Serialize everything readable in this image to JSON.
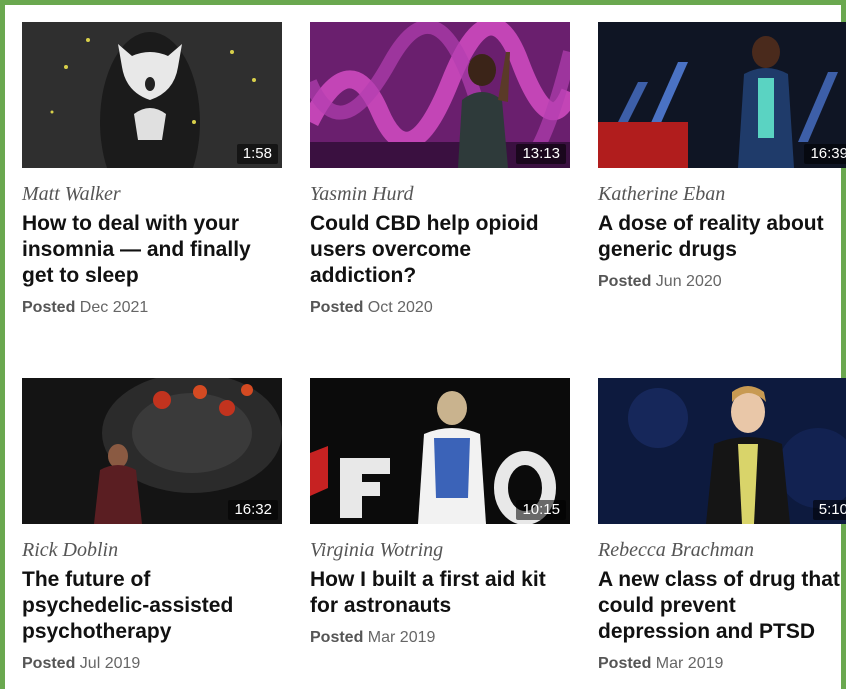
{
  "talks": [
    {
      "speaker": "Matt Walker",
      "title": "How to deal with your insomnia — and finally get to sleep",
      "duration": "1:58",
      "posted_label": "Posted",
      "posted_date": "Dec 2021"
    },
    {
      "speaker": "Yasmin Hurd",
      "title": "Could CBD help opioid users overcome addiction?",
      "duration": "13:13",
      "posted_label": "Posted",
      "posted_date": "Oct 2020"
    },
    {
      "speaker": "Katherine Eban",
      "title": "A dose of reality about generic drugs",
      "duration": "16:39",
      "posted_label": "Posted",
      "posted_date": "Jun 2020"
    },
    {
      "speaker": "Rick Doblin",
      "title": "The future of psychedelic-assisted psychotherapy",
      "duration": "16:32",
      "posted_label": "Posted",
      "posted_date": "Jul 2019"
    },
    {
      "speaker": "Virginia Wotring",
      "title": "How I built a first aid kit for astronauts",
      "duration": "10:15",
      "posted_label": "Posted",
      "posted_date": "Mar 2019"
    },
    {
      "speaker": "Rebecca Brachman",
      "title": "A new class of drug that could prevent depression and PTSD",
      "duration": "5:10",
      "posted_label": "Posted",
      "posted_date": "Mar 2019"
    }
  ],
  "colors": {
    "frame": "#6aa84f",
    "title": "#111111",
    "meta": "#666666"
  }
}
